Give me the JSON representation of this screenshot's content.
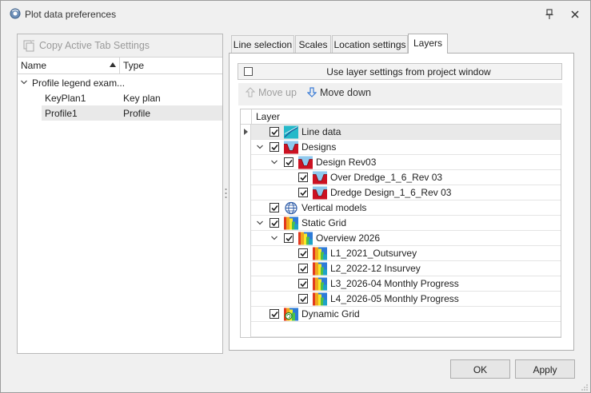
{
  "window": {
    "title": "Plot data preferences",
    "icons": {
      "app": "globe-gear-icon",
      "pin": "pin-icon",
      "close": "close-icon"
    }
  },
  "left": {
    "copy_button": "Copy Active Tab Settings",
    "columns": {
      "name": "Name",
      "type": "Type"
    },
    "group": "Profile legend exam...",
    "rows": [
      {
        "name": "KeyPlan1",
        "type": "Key plan"
      },
      {
        "name": "Profile1",
        "type": "Profile"
      }
    ]
  },
  "tabs": [
    "Line selection",
    "Scales",
    "Location settings",
    "Layers"
  ],
  "active_tab": "Layers",
  "layers": {
    "use_project_settings": "Use layer settings from project window",
    "move_up": "Move up",
    "move_down": "Move down",
    "column": "Layer",
    "items": [
      {
        "label": "Line data",
        "level": 0,
        "icon": "line-data-icon",
        "checked": true,
        "expander": "none",
        "selected": true
      },
      {
        "label": "Designs",
        "level": 0,
        "icon": "design-icon",
        "checked": true,
        "expander": "open"
      },
      {
        "label": "Design Rev03",
        "level": 1,
        "icon": "design-icon",
        "checked": true,
        "expander": "open"
      },
      {
        "label": "Over Dredge_1_6_Rev 03",
        "level": 2,
        "icon": "design-icon",
        "checked": true,
        "expander": "none"
      },
      {
        "label": "Dredge Design_1_6_Rev 03",
        "level": 2,
        "icon": "design-icon",
        "checked": true,
        "expander": "none"
      },
      {
        "label": "Vertical models",
        "level": 0,
        "icon": "globe-grid-icon",
        "checked": true,
        "expander": "none"
      },
      {
        "label": "Static Grid",
        "level": 0,
        "icon": "grid-icon",
        "checked": true,
        "expander": "open"
      },
      {
        "label": "Overview 2026",
        "level": 1,
        "icon": "grid-icon",
        "checked": true,
        "expander": "open"
      },
      {
        "label": "L1_2021_Outsurvey",
        "level": 2,
        "icon": "grid-icon",
        "checked": true,
        "expander": "none"
      },
      {
        "label": "L2_2022-12 Insurvey",
        "level": 2,
        "icon": "grid-icon",
        "checked": true,
        "expander": "none"
      },
      {
        "label": "L3_2026-04 Monthly Progress",
        "level": 2,
        "icon": "grid-icon",
        "checked": true,
        "expander": "none"
      },
      {
        "label": "L4_2026-05 Monthly Progress",
        "level": 2,
        "icon": "grid-icon",
        "checked": true,
        "expander": "none"
      },
      {
        "label": "Dynamic Grid",
        "level": 0,
        "icon": "dynamic-grid-icon",
        "checked": true,
        "expander": "none"
      }
    ]
  },
  "buttons": {
    "ok": "OK",
    "apply": "Apply"
  },
  "colors": {
    "accent_blue": "#3a7bd5",
    "design_red": "#cc1122",
    "window_bg": "#f0f0f0"
  }
}
